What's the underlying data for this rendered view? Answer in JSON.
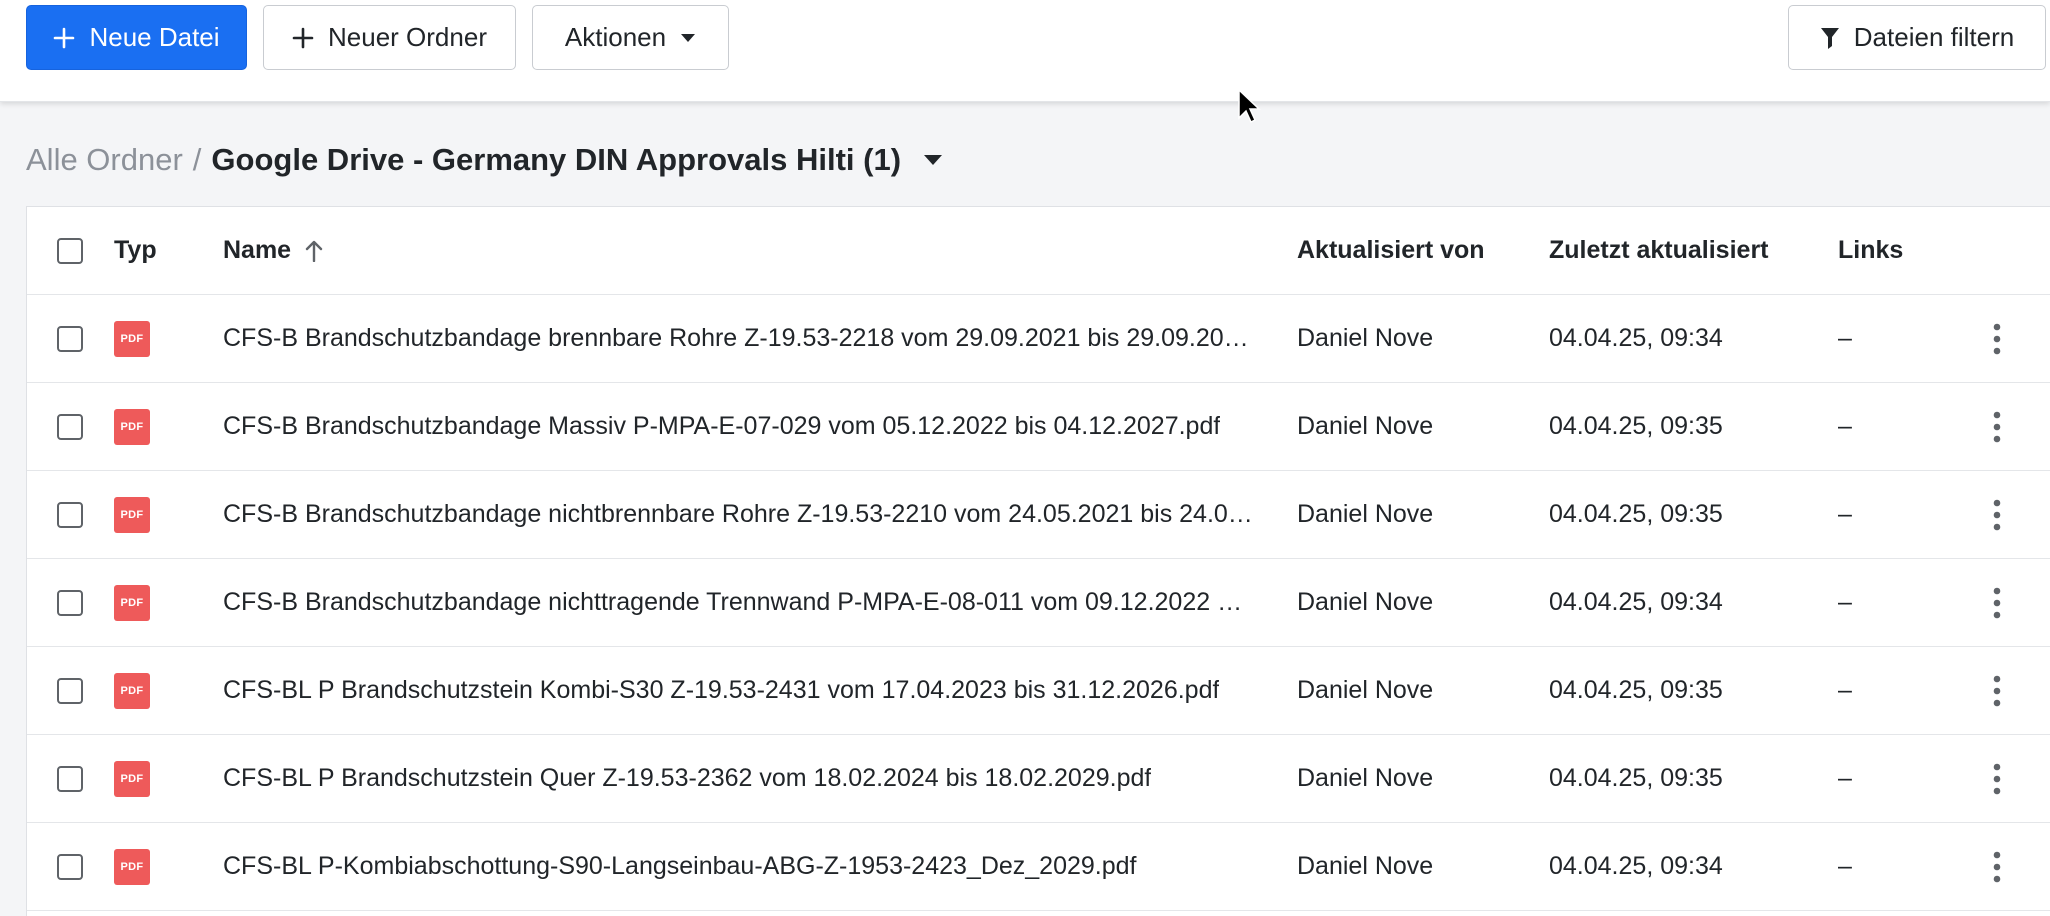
{
  "toolbar": {
    "new_file_label": "Neue Datei",
    "new_folder_label": "Neuer Ordner",
    "actions_label": "Aktionen",
    "filter_label": "Dateien filtern"
  },
  "breadcrumb": {
    "root": "Alle Ordner",
    "separator": "/",
    "current": "Google Drive - Germany DIN Approvals Hilti (1)"
  },
  "table": {
    "headers": {
      "type": "Typ",
      "name": "Name",
      "updated_by": "Aktualisiert von",
      "last_updated": "Zuletzt aktualisiert",
      "links": "Links"
    },
    "rows": [
      {
        "type": "PDF",
        "name": "CFS-B Brandschutzbandage brennbare Rohre Z-19.53-2218 vom 29.09.2021 bis 29.09.20…",
        "updated_by": "Daniel Nove",
        "last_updated": "04.04.25, 09:34",
        "links": "–"
      },
      {
        "type": "PDF",
        "name": "CFS-B Brandschutzbandage Massiv P-MPA-E-07-029 vom 05.12.2022 bis 04.12.2027.pdf",
        "updated_by": "Daniel Nove",
        "last_updated": "04.04.25, 09:35",
        "links": "–"
      },
      {
        "type": "PDF",
        "name": "CFS-B Brandschutzbandage nichtbrennbare Rohre Z-19.53-2210 vom 24.05.2021 bis 24.0…",
        "updated_by": "Daniel Nove",
        "last_updated": "04.04.25, 09:35",
        "links": "–"
      },
      {
        "type": "PDF",
        "name": "CFS-B Brandschutzbandage nichttragende Trennwand P-MPA-E-08-011 vom 09.12.2022 …",
        "updated_by": "Daniel Nove",
        "last_updated": "04.04.25, 09:34",
        "links": "–"
      },
      {
        "type": "PDF",
        "name": "CFS-BL P Brandschutzstein Kombi-S30 Z-19.53-2431 vom 17.04.2023 bis 31.12.2026.pdf",
        "updated_by": "Daniel Nove",
        "last_updated": "04.04.25, 09:35",
        "links": "–"
      },
      {
        "type": "PDF",
        "name": "CFS-BL P Brandschutzstein Quer Z-19.53-2362 vom 18.02.2024 bis 18.02.2029.pdf",
        "updated_by": "Daniel Nove",
        "last_updated": "04.04.25, 09:35",
        "links": "–"
      },
      {
        "type": "PDF",
        "name": "CFS-BL P-Kombiabschottung-S90-Langseinbau-ABG-Z-1953-2423_Dez_2029.pdf",
        "updated_by": "Daniel Nove",
        "last_updated": "04.04.25, 09:34",
        "links": "–"
      }
    ]
  },
  "icons": {
    "plus": "plus-icon",
    "caret": "caret-down-icon",
    "filter": "filter-icon",
    "sort": "arrow-up-icon",
    "more": "more-vertical-icon",
    "pdf": "pdf-file-icon"
  },
  "colors": {
    "primary": "#1a6ff2",
    "pdf_badge": "#ee5a5a",
    "muted_text": "#8c9199"
  }
}
